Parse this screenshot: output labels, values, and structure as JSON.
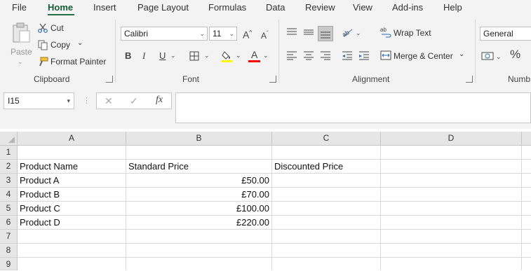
{
  "menu": {
    "tabs": [
      "File",
      "Home",
      "Insert",
      "Page Layout",
      "Formulas",
      "Data",
      "Review",
      "View",
      "Add-ins",
      "Help"
    ],
    "active": "Home"
  },
  "ribbon": {
    "clipboard": {
      "paste": "Paste",
      "cut": "Cut",
      "copy": "Copy",
      "format_painter": "Format Painter",
      "label": "Clipboard"
    },
    "font": {
      "name": "Calibri",
      "size": "11",
      "bold": "B",
      "italic": "I",
      "underline": "U",
      "grow": "A",
      "shrink": "A",
      "font_color_glyph": "A",
      "label": "Font"
    },
    "alignment": {
      "wrap_text": "Wrap Text",
      "merge_center": "Merge & Center",
      "label": "Alignment"
    },
    "number": {
      "format": "General",
      "percent": "%",
      "label": "Numb"
    }
  },
  "formula_bar": {
    "name_box": "I15",
    "fx": "fx",
    "content": ""
  },
  "sheet": {
    "columns": [
      "A",
      "B",
      "C",
      "D"
    ],
    "rows": [
      "1",
      "2",
      "3",
      "4",
      "5",
      "6",
      "7",
      "8",
      "9"
    ],
    "cells": [
      [
        "",
        "",
        "",
        ""
      ],
      [
        "Product Name",
        "Standard Price",
        "Discounted Price",
        ""
      ],
      [
        "Product A",
        "£50.00",
        "",
        ""
      ],
      [
        "Product B",
        "£70.00",
        "",
        ""
      ],
      [
        "Product C",
        "£100.00",
        "",
        ""
      ],
      [
        "Product D",
        "£220.00",
        "",
        ""
      ],
      [
        "",
        "",
        "",
        ""
      ],
      [
        "",
        "",
        "",
        ""
      ],
      [
        "",
        "",
        "",
        ""
      ]
    ]
  },
  "colors": {
    "accent": "#217346",
    "highlight": "#ffff00",
    "font_color": "#ff0000"
  },
  "icons": [
    "paste-icon",
    "cut-icon",
    "copy-icon",
    "format-painter-icon",
    "borders-icon",
    "fill-color-icon",
    "font-color-icon",
    "orientation-icon",
    "wrap-text-icon",
    "merge-center-icon",
    "accounting-format-icon",
    "cancel-icon",
    "enter-icon",
    "insert-function-icon"
  ]
}
